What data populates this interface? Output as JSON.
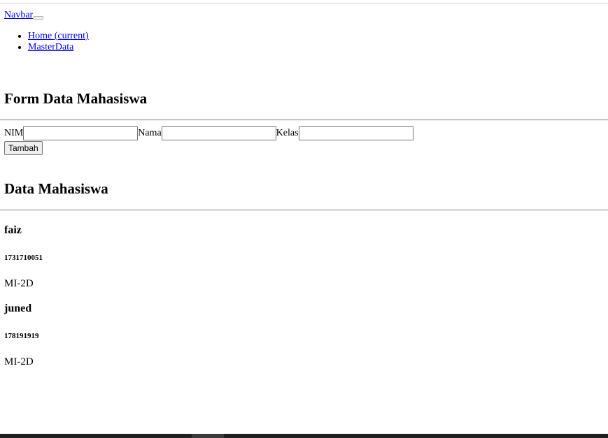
{
  "navbar": {
    "brand": "Navbar",
    "toggler_icon": "navbar-toggler-icon",
    "items": [
      {
        "label": "Home (current)"
      },
      {
        "label": "MasterData"
      }
    ]
  },
  "form": {
    "title": "Form Data Mahasiswa",
    "fields": [
      {
        "label": "NIM",
        "value": ""
      },
      {
        "label": "Nama",
        "value": ""
      },
      {
        "label": "Kelas",
        "value": ""
      }
    ],
    "submit_label": "Tambah"
  },
  "list": {
    "title": "Data Mahasiswa",
    "records": [
      {
        "name": "faiz",
        "nim": "1731710051",
        "kelas": "MI-2D"
      },
      {
        "name": "juned",
        "nim": "178191919",
        "kelas": "MI-2D"
      }
    ]
  },
  "colors": {
    "link": "#0000ee",
    "taskbar": "#1f1f1f"
  }
}
